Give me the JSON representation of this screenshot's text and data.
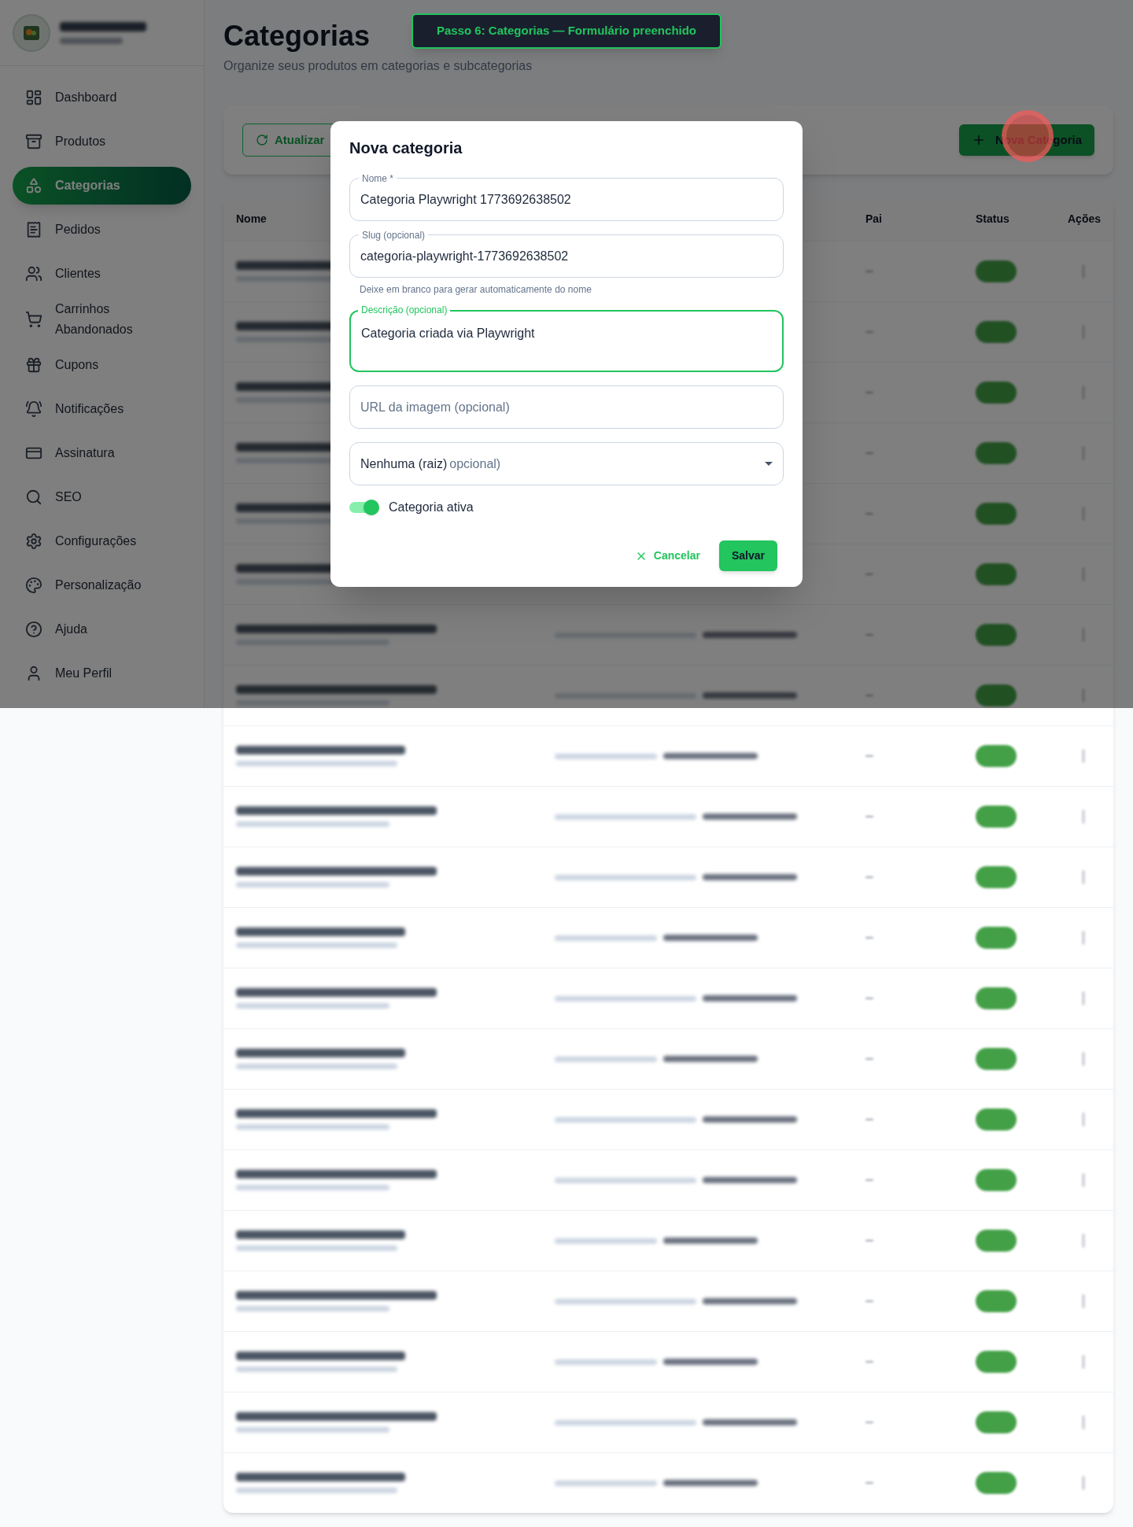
{
  "sidebar": {
    "items": [
      {
        "label": "Dashboard",
        "selected": false
      },
      {
        "label": "Produtos",
        "selected": false
      },
      {
        "label": "Categorias",
        "selected": true
      },
      {
        "label": "Pedidos",
        "selected": false
      },
      {
        "label": "Clientes",
        "selected": false
      },
      {
        "label": "Carrinhos Abandonados",
        "selected": false
      },
      {
        "label": "Cupons",
        "selected": false
      },
      {
        "label": "Notificações",
        "selected": false
      },
      {
        "label": "Assinatura",
        "selected": false
      },
      {
        "label": "SEO",
        "selected": false
      },
      {
        "label": "Configurações",
        "selected": false
      },
      {
        "label": "Personalização",
        "selected": false
      },
      {
        "label": "Ajuda",
        "selected": false
      },
      {
        "label": "Meu Perfil",
        "selected": false
      }
    ]
  },
  "page": {
    "title": "Categorias",
    "subtitle": "Organize seus produtos em categorias e subcategorias"
  },
  "toast": "Passo 6: Categorias — Formulário preenchido",
  "toolbar": {
    "refresh_button": "Atualizar",
    "new_button": "Nova Categoria"
  },
  "table": {
    "columns": [
      "Nome",
      "Pai",
      "Status",
      "Ações"
    ],
    "rows": [
      {
        "kind": "medium"
      },
      {
        "kind": "long"
      },
      {
        "kind": "short"
      },
      {
        "kind": "short"
      },
      {
        "kind": "short"
      },
      {
        "kind": "short"
      },
      {
        "kind": "long"
      },
      {
        "kind": "long"
      },
      {
        "kind": "short"
      },
      {
        "kind": "long"
      },
      {
        "kind": "long"
      },
      {
        "kind": "short"
      },
      {
        "kind": "long"
      },
      {
        "kind": "short"
      },
      {
        "kind": "long"
      },
      {
        "kind": "long"
      },
      {
        "kind": "short"
      },
      {
        "kind": "long"
      },
      {
        "kind": "short"
      },
      {
        "kind": "long"
      },
      {
        "kind": "short"
      }
    ]
  },
  "dialog": {
    "title": "Nova categoria",
    "fields": [
      {
        "kind": "text",
        "label": "Nome *",
        "value": "Categoria Playwright 1773692638502",
        "focused": false
      },
      {
        "kind": "text",
        "label": "Slug (opcional)",
        "value": "categoria-playwright-1773692638502",
        "focused": false,
        "helper": "Deixe em branco para gerar automaticamente do nome"
      },
      {
        "kind": "textarea",
        "label": "Descrição (opcional)",
        "value": "Categoria criada via Playwright",
        "focused": true
      },
      {
        "kind": "text",
        "placeholder": "URL da imagem (opcional)",
        "focused": false
      },
      {
        "kind": "select",
        "label": "opcional)",
        "value": "Nenhuma (raiz)",
        "focused": false
      }
    ],
    "toggle": {
      "label": "Categoria ativa",
      "on": true
    },
    "cancel_button": "Cancelar",
    "save_button": "Salvar"
  }
}
